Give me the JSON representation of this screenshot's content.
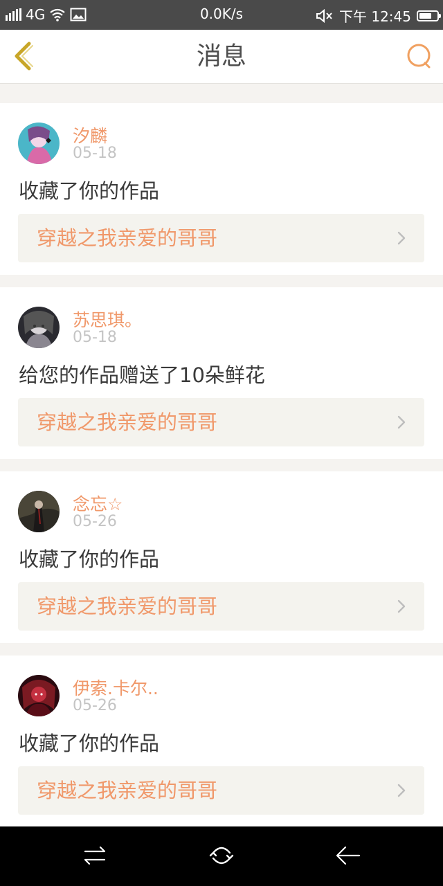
{
  "status_bar": {
    "network": "4G",
    "speed": "0.0K/s",
    "time": "下午 12:45",
    "battery_level": 0.7
  },
  "header": {
    "title": "消息",
    "back_icon": "chevron-left-icon",
    "search_icon": "search-icon"
  },
  "messages": [
    {
      "name": "汐麟",
      "date": "05-18",
      "action": "收藏了你的作品",
      "work": "穿越之我亲爱的哥哥"
    },
    {
      "name": "苏思琪。",
      "date": "05-18",
      "action": "给您的作品赠送了10朵鲜花",
      "work": "穿越之我亲爱的哥哥"
    },
    {
      "name": "念忘☆",
      "date": "05-26",
      "action": "收藏了你的作品",
      "work": "穿越之我亲爱的哥哥"
    },
    {
      "name": "伊索.卡尔..",
      "date": "05-26",
      "action": "收藏了你的作品",
      "work": "穿越之我亲爱的哥哥"
    }
  ],
  "colors": {
    "accent": "#f0986a",
    "back_icon": "#c8a628",
    "search_icon": "#f0a060"
  }
}
